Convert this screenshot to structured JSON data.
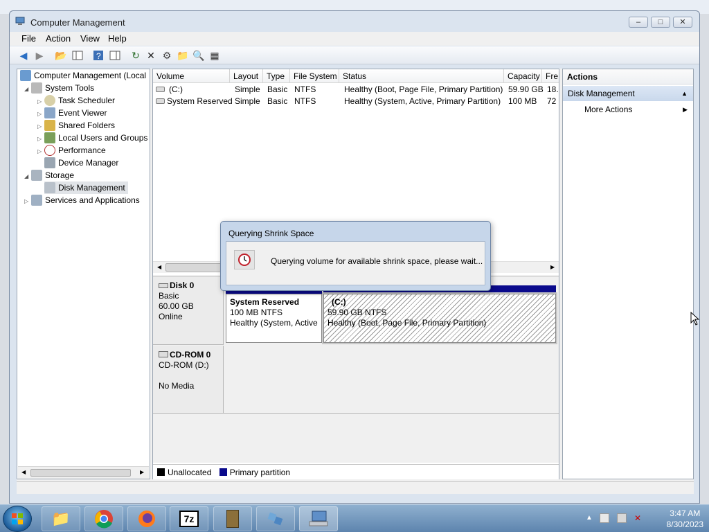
{
  "window": {
    "title": "Computer Management"
  },
  "menu": [
    "File",
    "Action",
    "View",
    "Help"
  ],
  "tree": {
    "root": "Computer Management (Local",
    "system_tools": "System Tools",
    "task_scheduler": "Task Scheduler",
    "event_viewer": "Event Viewer",
    "shared_folders": "Shared Folders",
    "local_users": "Local Users and Groups",
    "performance": "Performance",
    "device_manager": "Device Manager",
    "storage": "Storage",
    "disk_management": "Disk Management",
    "services": "Services and Applications"
  },
  "volume_list": {
    "columns": [
      "Volume",
      "Layout",
      "Type",
      "File System",
      "Status",
      "Capacity",
      "Fre"
    ],
    "rows": [
      {
        "volume": "(C:)",
        "layout": "Simple",
        "type": "Basic",
        "fs": "NTFS",
        "status": "Healthy (Boot, Page File, Primary Partition)",
        "capacity": "59.90 GB",
        "free": "18."
      },
      {
        "volume": "System Reserved",
        "layout": "Simple",
        "type": "Basic",
        "fs": "NTFS",
        "status": "Healthy (System, Active, Primary Partition)",
        "capacity": "100 MB",
        "free": "72"
      }
    ]
  },
  "disks": {
    "disk0": {
      "name": "Disk 0",
      "type": "Basic",
      "size": "60.00 GB",
      "state": "Online"
    },
    "cdrom0": {
      "name": "CD-ROM 0",
      "label": "CD-ROM (D:)",
      "media": "No Media"
    }
  },
  "partitions": {
    "reserved": {
      "name": "System Reserved",
      "size": "100 MB NTFS",
      "status": "Healthy (System, Active"
    },
    "c": {
      "name": "(C:)",
      "size": "59.90 GB NTFS",
      "status": "Healthy (Boot, Page File, Primary Partition)"
    }
  },
  "legend": {
    "unallocated": "Unallocated",
    "primary": "Primary partition"
  },
  "actions": {
    "header": "Actions",
    "section": "Disk Management",
    "more": "More Actions"
  },
  "dialog": {
    "title": "Querying Shrink Space",
    "message": "Querying volume for available shrink space, please wait..."
  },
  "clock": {
    "time": "3:47 AM",
    "date": "8/30/2023"
  },
  "colors": {
    "primary_partition": "#0a0a8c",
    "unallocated": "#000000"
  }
}
